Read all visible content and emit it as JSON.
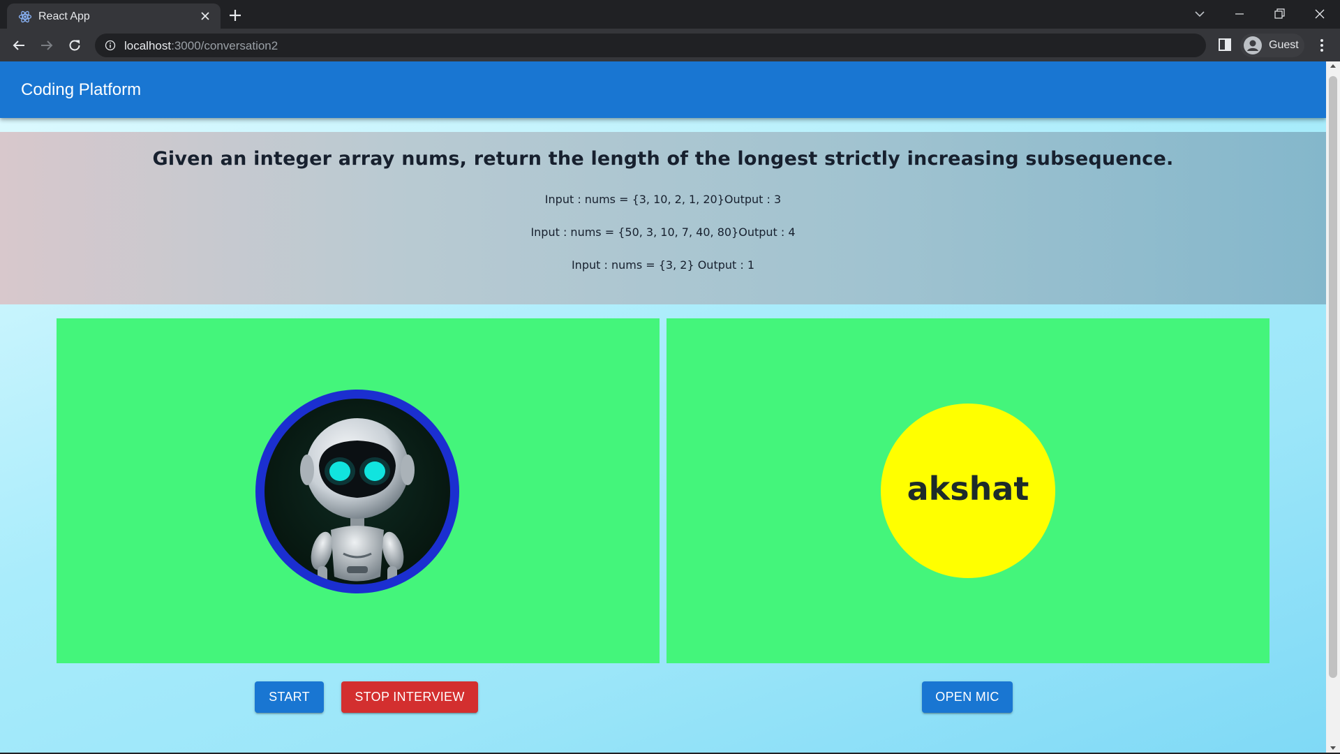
{
  "browser": {
    "tab_title": "React App",
    "url_host": "localhost",
    "url_path": ":3000/conversation2",
    "profile_label": "Guest"
  },
  "app": {
    "title": "Coding Platform"
  },
  "question": {
    "title": "Given an integer array nums, return the length of the longest strictly increasing subsequence.",
    "examples": [
      "Input : nums = {3, 10, 2, 1, 20}Output : 3",
      "Input : nums = {50, 3, 10, 7, 40, 80}Output : 4",
      "Input : nums = {3, 2} Output : 1"
    ]
  },
  "participants": {
    "user_name": "akshat"
  },
  "controls": {
    "start_label": "START",
    "stop_label": "STOP INTERVIEW",
    "mic_label": "OPEN MIC"
  },
  "colors": {
    "appbar": "#1976d2",
    "panel": "#44f57b",
    "user_avatar": "#ffff00",
    "robot_ring": "#1b2fd0",
    "stop_button": "#d32f2f"
  }
}
